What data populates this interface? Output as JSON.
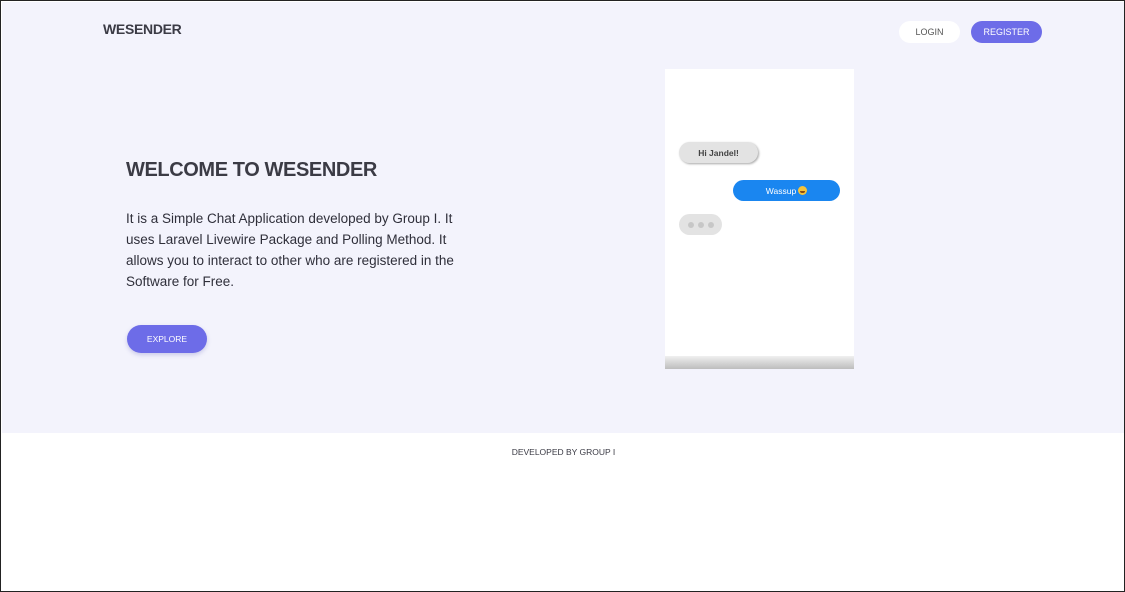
{
  "header": {
    "brand": "WESENDER",
    "login_label": "LOGIN",
    "register_label": "REGISTER"
  },
  "hero": {
    "title": "WELCOME TO WESENDER",
    "description": "It is a Simple Chat Application developed by Group I. It uses Laravel Livewire Package and Polling Method. It allows you to interact to other who are registered in the Software for Free.",
    "explore_label": "EXPLORE"
  },
  "chat_preview": {
    "incoming_message": "Hi Jandel!",
    "outgoing_message": "Wassup",
    "outgoing_emoji": "grinning-face-icon",
    "typing_indicator": "typing-dots-icon"
  },
  "footer": {
    "text": "DEVELOPED BY GROUP I"
  },
  "colors": {
    "accent": "#6d6ce8",
    "hero_background": "#f3f3fc",
    "outgoing_bubble": "#1a86f0",
    "incoming_bubble": "#e3e3e3"
  }
}
